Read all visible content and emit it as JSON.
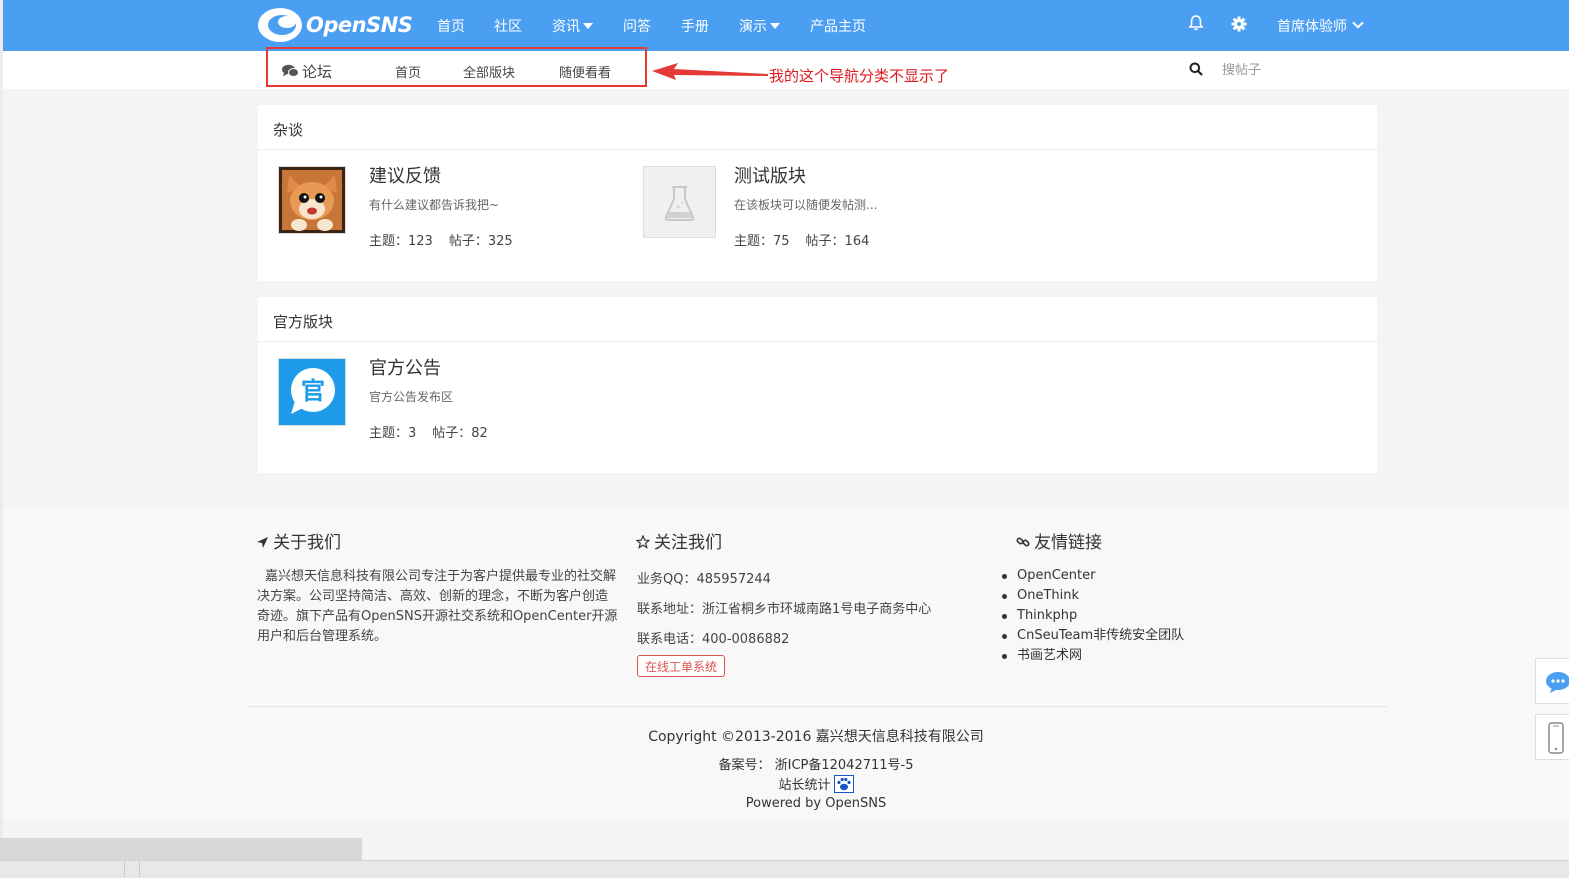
{
  "navbar": {
    "logo_text": "OpenSNS",
    "items": [
      {
        "label": "首页",
        "dropdown": false
      },
      {
        "label": "社区",
        "dropdown": false
      },
      {
        "label": "资讯",
        "dropdown": true
      },
      {
        "label": "问答",
        "dropdown": false
      },
      {
        "label": "手册",
        "dropdown": false
      },
      {
        "label": "演示",
        "dropdown": true
      },
      {
        "label": "产品主页",
        "dropdown": false
      }
    ],
    "user_label": "首席体验师",
    "icons": [
      "bell-icon",
      "gear-icon"
    ],
    "accent": "#4b9ff2"
  },
  "subnav": {
    "title": "论坛",
    "items": [
      "首页",
      "全部版块",
      "随便看看"
    ],
    "search_placeholder": "搜帖子"
  },
  "annotation": {
    "text": "我的这个导航分类不显示了",
    "color": "#e0191f"
  },
  "sections": [
    {
      "title": "杂谈",
      "forums": [
        {
          "name": "建议反馈",
          "desc": "有什么建议都告诉我把~",
          "topics_label": "主题：123",
          "posts_label": "帖子：325",
          "icon": "cat-avatar"
        },
        {
          "name": "测试版块",
          "desc": "在该板块可以随便发帖测...",
          "topics_label": "主题：75",
          "posts_label": "帖子：164",
          "icon": "flask-placeholder-icon"
        }
      ]
    },
    {
      "title": "官方版块",
      "forums": [
        {
          "name": "官方公告",
          "desc": "官方公告发布区",
          "topics_label": "主题：3",
          "posts_label": "帖子：82",
          "icon": "official-badge",
          "icon_char": "官"
        }
      ]
    }
  ],
  "footer": {
    "about": {
      "title": "关于我们",
      "text": "嘉兴想天信息科技有限公司专注于为客户提供最专业的社交解决方案。公司坚持简洁、高效、创新的理念，不断为客户创造奇迹。旗下产品有OpenSNS开源社交系统和OpenCenter开源用户和后台管理系统。"
    },
    "follow": {
      "title": "关注我们",
      "qq": "业务QQ：485957244",
      "address": "联系地址：浙江省桐乡市环城南路1号电子商务中心",
      "phone": "联系电话：400-0086882",
      "ticket_button": "在线工单系统"
    },
    "links": {
      "title": "友情链接",
      "items": [
        "OpenCenter",
        "OneThink",
        "Thinkphp",
        "CnSeuTeam非传统安全团队",
        "书画艺术网"
      ]
    },
    "copyright": "Copyright ©2013-2016 嘉兴想天信息科技有限公司",
    "icp": "备案号： 浙ICP备12042711号-5",
    "stats": "站长统计",
    "powered": "Powered by OpenSNS"
  }
}
